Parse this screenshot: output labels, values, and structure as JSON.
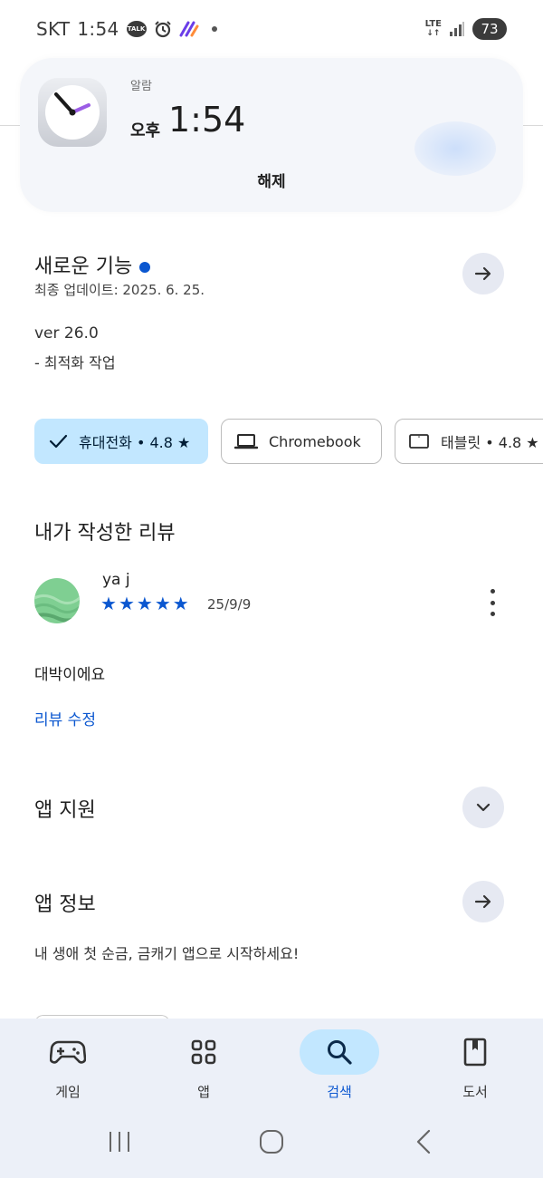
{
  "status_bar": {
    "carrier": "SKT",
    "time": "1:54",
    "talk_badge": "TALK",
    "network": "LTE",
    "battery": "73"
  },
  "notification": {
    "app_name": "알람",
    "ampm": "오후",
    "time": "1:54",
    "dismiss_label": "해제"
  },
  "whats_new": {
    "title": "새로운 기능",
    "last_updated": "최종 업데이트: 2025. 6. 25.",
    "version": "ver 26.0",
    "notes": "- 최적화 작업"
  },
  "device_chips": [
    {
      "label": "휴대전화 • 4.8 ★",
      "selected": true
    },
    {
      "label": "Chromebook",
      "selected": false
    },
    {
      "label": "태블릿 • 4.8 ★",
      "selected": false
    }
  ],
  "my_review": {
    "title": "내가 작성한 리뷰",
    "reviewer": "ya j",
    "stars": 5,
    "date": "25/9/9",
    "text": "대박이에요",
    "edit_label": "리뷰 수정"
  },
  "app_support": {
    "title": "앱 지원"
  },
  "app_info": {
    "title": "앱 정보",
    "description": "내 생애 첫 순금, 금캐기 앱으로 시작하세요!"
  },
  "bottom_nav": [
    {
      "label": "게임",
      "icon": "gamepad-icon",
      "active": false
    },
    {
      "label": "앱",
      "icon": "apps-grid-icon",
      "active": false
    },
    {
      "label": "검색",
      "icon": "search-icon",
      "active": true
    },
    {
      "label": "도서",
      "icon": "book-icon",
      "active": false
    }
  ],
  "colors": {
    "accent": "#0b57d0",
    "chip_selected": "#c2e7ff",
    "nav_bg": "#ecf0f8"
  }
}
